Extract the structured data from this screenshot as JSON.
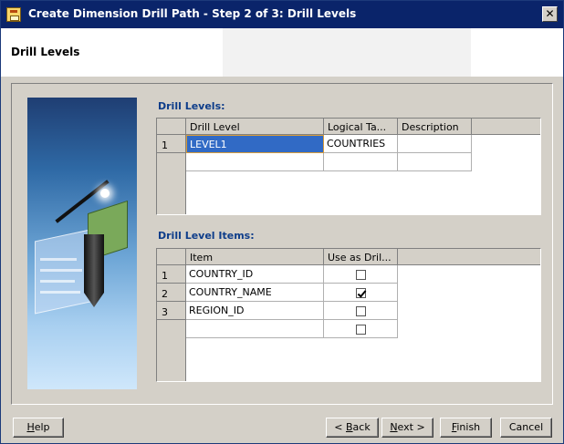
{
  "window": {
    "title": "Create Dimension Drill Path - Step 2 of 3: Drill Levels",
    "close_glyph": "✕"
  },
  "header": {
    "title": "Drill Levels"
  },
  "drill_levels": {
    "label": "Drill Levels:",
    "columns": [
      "Drill Level",
      "Logical Ta...",
      "Description"
    ],
    "rows": [
      {
        "num": "1",
        "drill_level": "LEVEL1",
        "logical_table": "COUNTRIES",
        "description": ""
      }
    ]
  },
  "drill_level_items": {
    "label": "Drill Level Items:",
    "columns": [
      "Item",
      "Use as Dril..."
    ],
    "rows": [
      {
        "num": "1",
        "item": "COUNTRY_ID",
        "use_as_drill": false
      },
      {
        "num": "2",
        "item": "COUNTRY_NAME",
        "use_as_drill": true
      },
      {
        "num": "3",
        "item": "REGION_ID",
        "use_as_drill": false
      }
    ]
  },
  "buttons": {
    "help": {
      "mnemonic": "H",
      "rest": "elp"
    },
    "back": {
      "prefix": "< ",
      "mnemonic": "B",
      "rest": "ack"
    },
    "next": {
      "mnemonic": "N",
      "rest": "ext >"
    },
    "finish": {
      "mnemonic": "F",
      "rest": "inish"
    },
    "cancel": "Cancel"
  },
  "colors": {
    "title_bar": "#0a246a",
    "section_label": "#0e3d8a",
    "selection": "#316ac5"
  }
}
